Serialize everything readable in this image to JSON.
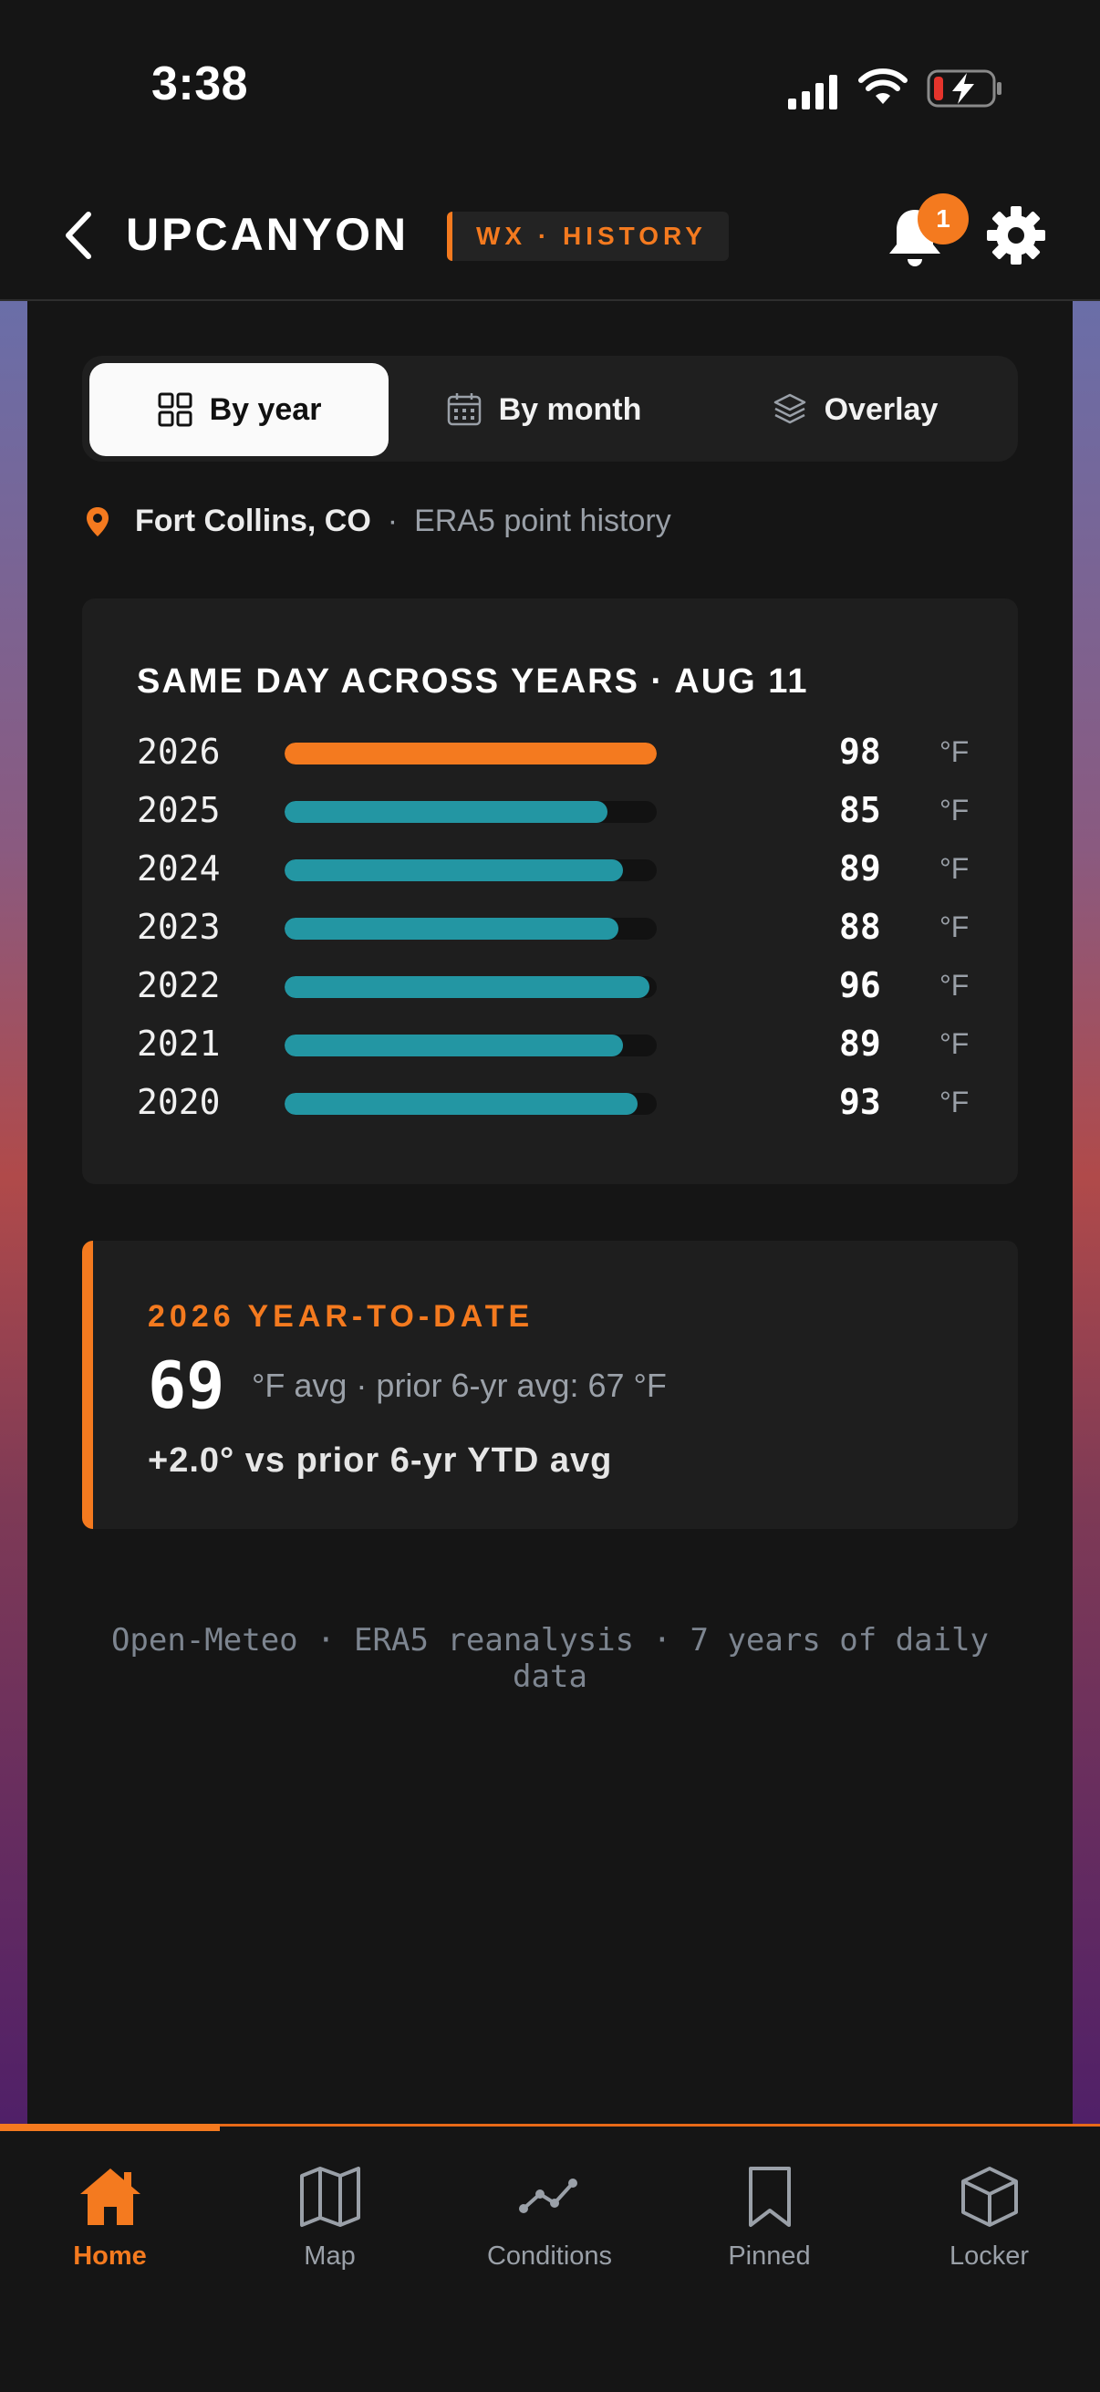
{
  "status_bar": {
    "time": "3:38",
    "icons": [
      "signal-icon",
      "wifi-icon",
      "battery-charging-icon"
    ]
  },
  "header": {
    "title": "UPCANYON",
    "badge": "WX · HISTORY",
    "notification_count": "1",
    "icons": [
      "back-chevron-icon",
      "bell-icon",
      "gear-icon"
    ]
  },
  "tabs": [
    {
      "label": "By year",
      "icon": "grid-icon",
      "active": true
    },
    {
      "label": "By month",
      "icon": "calendar-icon",
      "active": false
    },
    {
      "label": "Overlay",
      "icon": "layers-icon",
      "active": false
    }
  ],
  "location": {
    "name": "Fort Collins, CO",
    "separator": "·",
    "source": "ERA5 point history"
  },
  "chart_data": {
    "type": "bar",
    "title": "SAME DAY ACROSS YEARS · AUG 11",
    "orientation": "horizontal",
    "unit": "°F",
    "scale_max": 98,
    "categories": [
      "2026",
      "2025",
      "2024",
      "2023",
      "2022",
      "2021",
      "2020"
    ],
    "values": [
      98,
      85,
      89,
      88,
      96,
      89,
      93
    ],
    "highlight_category": "2026",
    "colors": {
      "highlight": "#f47a1f",
      "default": "#2396a3"
    }
  },
  "ytd": {
    "label": "2026 YEAR-TO-DATE",
    "value": "69",
    "subtitle": "°F avg · prior 6-yr avg: 67 °F",
    "delta": "+2.0° vs prior 6-yr YTD avg"
  },
  "footnote": "Open-Meteo · ERA5 reanalysis · 7 years of daily data",
  "bottom_nav": [
    {
      "label": "Home",
      "icon": "home-icon",
      "active": true
    },
    {
      "label": "Map",
      "icon": "map-icon",
      "active": false
    },
    {
      "label": "Conditions",
      "icon": "trend-line-icon",
      "active": false
    },
    {
      "label": "Pinned",
      "icon": "bookmark-icon",
      "active": false
    },
    {
      "label": "Locker",
      "icon": "cube-icon",
      "active": false
    }
  ],
  "colors": {
    "accent": "#f47a1f",
    "teal": "#2396a3",
    "background": "#151515",
    "card": "#1e1e1e"
  }
}
